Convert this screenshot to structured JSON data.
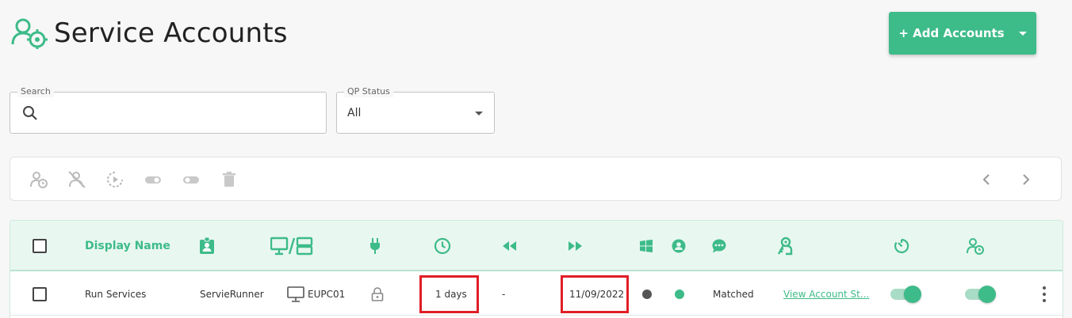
{
  "page": {
    "title": "Service Accounts",
    "title_icon": "user-gear-icon"
  },
  "header": {
    "add_button_label": "+ Add Accounts"
  },
  "search": {
    "label": "Search",
    "value": "",
    "placeholder": ""
  },
  "qp_status": {
    "label": "QP Status",
    "selected": "All"
  },
  "toolbar": {
    "icons": [
      "user-clock-icon",
      "user-off-icon",
      "refresh-timer-icon",
      "toggle-off-icon",
      "toggle-off-icon",
      "trash-icon"
    ],
    "pager": [
      "chevron-left-icon",
      "chevron-right-icon"
    ]
  },
  "table": {
    "columns": [
      {
        "key": "select",
        "label": ""
      },
      {
        "key": "display_name",
        "label": "Display Name"
      },
      {
        "key": "account",
        "icon": "id-badge-icon"
      },
      {
        "key": "host",
        "icon": "monitor-server-icon"
      },
      {
        "key": "plug",
        "icon": "plug-icon"
      },
      {
        "key": "age",
        "icon": "clock-icon"
      },
      {
        "key": "previous",
        "icon": "rewind-icon"
      },
      {
        "key": "next",
        "icon": "fast-forward-icon"
      },
      {
        "key": "os",
        "icon": "windows-icon"
      },
      {
        "key": "user",
        "icon": "user-circle-icon"
      },
      {
        "key": "comment",
        "icon": "chat-icon"
      },
      {
        "key": "keys",
        "icon": "key-person-icon"
      },
      {
        "key": "timer",
        "icon": "timer-icon"
      },
      {
        "key": "user_clock",
        "icon": "user-clock-icon"
      }
    ],
    "rows": [
      {
        "display_name": "Run Services",
        "account": "ServieRunner",
        "host": "EUPC01",
        "age": "1 days",
        "previous": "-",
        "next": "11/09/2022",
        "status": "Matched",
        "link": "View Account St..."
      }
    ]
  },
  "colors": {
    "accent": "#3dbb89",
    "highlight": "#e01e26",
    "dot_dark": "#555555"
  }
}
